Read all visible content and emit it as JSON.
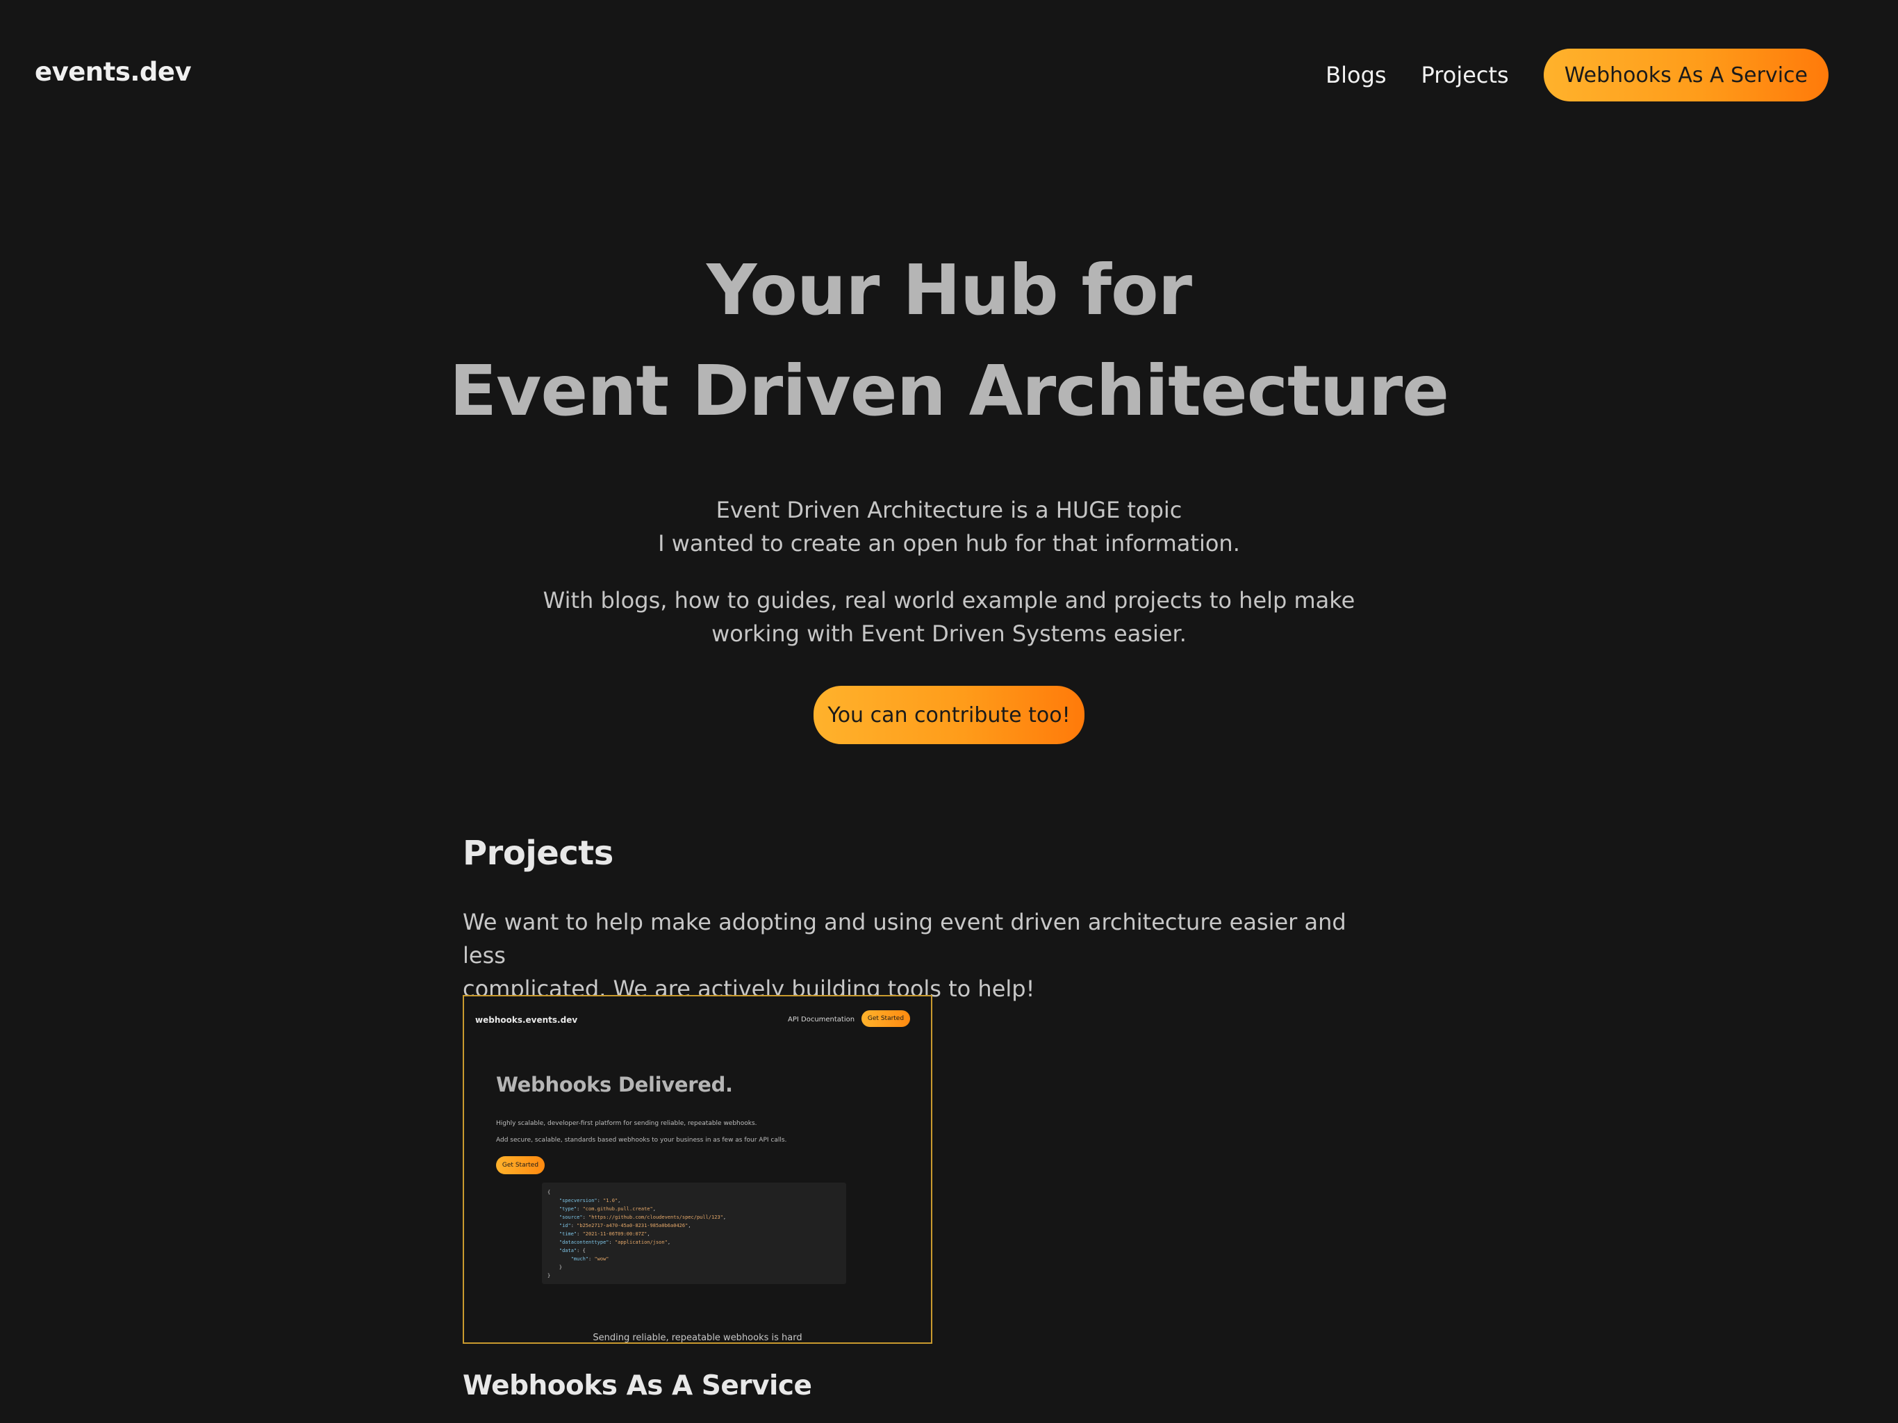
{
  "header": {
    "logo": "events.dev",
    "nav": {
      "blogs": "Blogs",
      "projects": "Projects",
      "cta": "Webhooks As A Service"
    }
  },
  "hero": {
    "title_line1": "Your Hub for",
    "title_line2": "Event Driven Architecture",
    "p1_line1": "Event Driven Architecture is a HUGE topic",
    "p1_line2": "I wanted to create an open hub for that information.",
    "p2_line1": "With blogs, how to guides, real world example and projects to help make",
    "p2_line2": "working with Event Driven Systems easier.",
    "cta": "You can contribute too!"
  },
  "projects": {
    "heading": "Projects",
    "desc_line1": "We want to help make adopting and using event driven architecture easier and less",
    "desc_line2": "complicated. We are actively building tools to help!",
    "items": [
      {
        "title": "Webhooks As A Service",
        "preview": {
          "logo": "webhooks.events.dev",
          "nav_link": "API Documentation",
          "nav_cta": "Get Started",
          "title": "Webhooks Delivered.",
          "text1": "Highly scalable, developer-first platform for sending reliable, repeatable webhooks.",
          "text2": "Add secure, scalable, standards based webhooks to your business in as few as four API calls.",
          "button": "Get Started",
          "code": {
            "open": "{",
            "specversion_key": "\"specversion\"",
            "specversion_val": "\"1.0\"",
            "type_key": "\"type\"",
            "type_val": "\"com.github.pull.create\"",
            "source_key": "\"source\"",
            "source_val": "\"https://github.com/cloudevents/spec/pull/123\"",
            "id_key": "\"id\"",
            "id_val": "\"b25e2717-a470-45a0-8231-985a0b6a0426\"",
            "time_key": "\"time\"",
            "time_val": "\"2021-11-06T09:00:07Z\"",
            "dct_key": "\"datacontenttype\"",
            "dct_val": "\"application/json\"",
            "data_key": "\"data\"",
            "much_key": "\"much\"",
            "much_val": "\"wow\""
          },
          "footer": "Sending reliable, repeatable webhooks is hard"
        }
      }
    ]
  },
  "colors": {
    "background": "#151515",
    "accent_start": "#ffb22c",
    "accent_end": "#ff7a0a",
    "card_border": "#c99a2e"
  }
}
